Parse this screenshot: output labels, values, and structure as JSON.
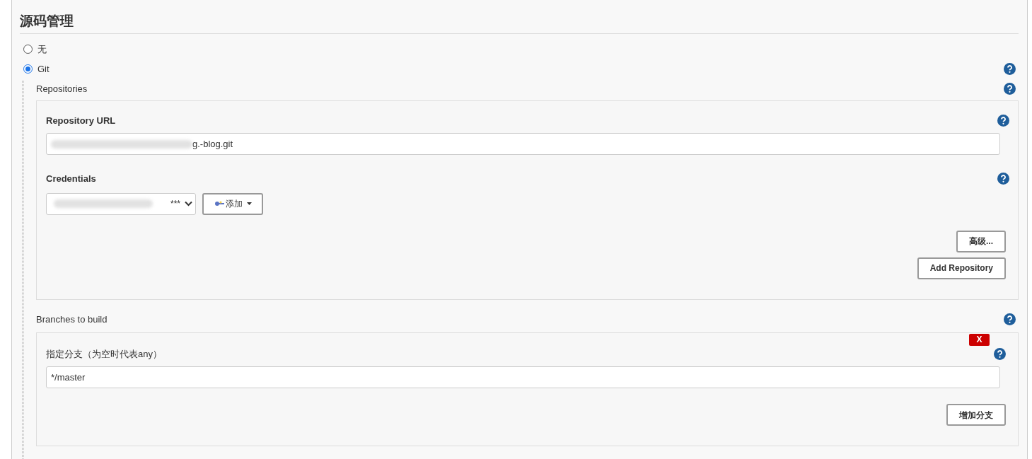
{
  "section": {
    "title": "源码管理"
  },
  "scm_options": [
    {
      "label": "无",
      "selected": false,
      "help": false
    },
    {
      "label": "Git",
      "selected": true,
      "help": true
    }
  ],
  "repositories": {
    "label": "Repositories",
    "help": true,
    "url": {
      "label": "Repository URL",
      "value": "g.-blog.git",
      "redacted": true
    },
    "credentials": {
      "label": "Credentials",
      "value": "***",
      "redacted": true,
      "add_button": "添加"
    },
    "buttons": [
      "高级...",
      "Add Repository"
    ]
  },
  "branches": {
    "label": "Branches to build",
    "help": true,
    "delete_button": "X",
    "branch": {
      "label": "指定分支（为空时代表any）",
      "value": "*/master"
    },
    "add_button": "增加分支"
  }
}
